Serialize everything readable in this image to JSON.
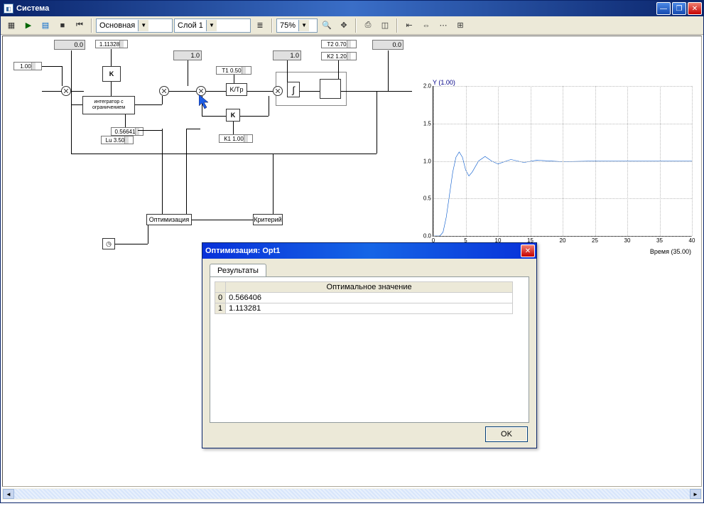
{
  "window": {
    "title": "Система"
  },
  "toolbar": {
    "combo1": "Основная",
    "combo2": "Слой 1",
    "zoom": "75%"
  },
  "blocks": {
    "const1": "1.00",
    "readout1": "0.0",
    "param_k": "1.11328",
    "k_block": "K",
    "integrator_label": "интегратор с ограничением",
    "param_out": "0.56641",
    "param_lu": "Lu  3.50",
    "readout2": "1.0",
    "param_t1": "T1  0.50",
    "ktp": "K/Tp",
    "readout3": "1.0",
    "int_sym": "∫",
    "k2_block": "K",
    "param_k1": "K1  1.00",
    "param_t2": "T2  0.70",
    "param_k2": "K2  1.20",
    "readout4": "0.0",
    "opt_block": "Оптимизация",
    "crit_block": "Критерий"
  },
  "dialog": {
    "title": "Оптимизация: Opt1",
    "tab": "Результаты",
    "header": "Оптимальное значение",
    "rows": [
      {
        "idx": "0",
        "val": "0.566406"
      },
      {
        "idx": "1",
        "val": "1.113281"
      }
    ],
    "ok": "OK"
  },
  "chart_data": {
    "type": "line",
    "title": "Y (1.00)",
    "xlabel": "Время (35.00)",
    "ylabel": "",
    "xlim": [
      0,
      40
    ],
    "ylim": [
      0,
      2.0
    ],
    "x_ticks": [
      0,
      5,
      10,
      15,
      20,
      25,
      30,
      35,
      40
    ],
    "y_ticks": [
      0,
      0.5,
      1.0,
      1.5,
      2.0
    ],
    "series": [
      {
        "name": "Y",
        "color": "#0055CC",
        "x": [
          0,
          1.0,
          1.5,
          2.0,
          2.5,
          3.0,
          3.5,
          4.0,
          4.5,
          5.0,
          5.5,
          6.0,
          7.0,
          8.0,
          9.0,
          10.0,
          12.0,
          14.0,
          16.0,
          20.0,
          25.0,
          30.0,
          35.0,
          40.0
        ],
        "values": [
          0,
          0.0,
          0.05,
          0.25,
          0.55,
          0.85,
          1.05,
          1.12,
          1.05,
          0.88,
          0.8,
          0.85,
          1.0,
          1.06,
          1.0,
          0.96,
          1.02,
          0.98,
          1.01,
          0.99,
          1.0,
          1.0,
          1.0,
          1.0
        ]
      }
    ]
  }
}
